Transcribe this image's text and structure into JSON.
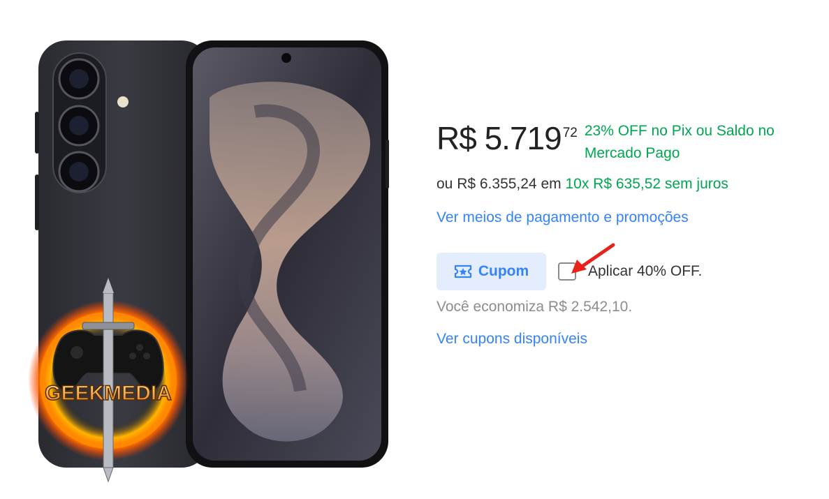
{
  "price": {
    "currency_value": "R$ 5.719",
    "cents": "72",
    "pix_discount": "23% OFF no Pix ou Saldo no Mercado Pago"
  },
  "installments": {
    "prefix": "ou R$ 6.355,24 em",
    "detail": "10x R$ 635,52 sem juros"
  },
  "links": {
    "payment_methods": "Ver meios de pagamento e promoções",
    "available_coupons": "Ver cupons disponíveis"
  },
  "coupon": {
    "button_label": "Cupom",
    "apply_label": "Aplicar 40% OFF.",
    "checkbox_checked": false,
    "savings_text": "Você economiza R$ 2.542,10."
  },
  "watermark": {
    "text": "GEEKMEDIA"
  },
  "colors": {
    "green": "#00a650",
    "link_blue": "#3483fa",
    "coupon_bg": "#e3edfb",
    "annotation_red": "#e8221b"
  },
  "icons": [
    "ticket-star-icon",
    "red-arrow-icon"
  ]
}
